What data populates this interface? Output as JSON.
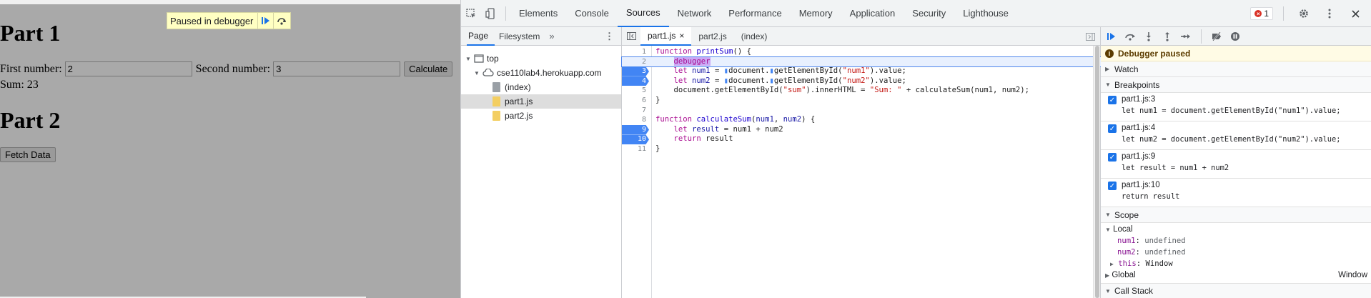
{
  "page": {
    "part1_heading": "Part 1",
    "first_number_label": "First number:",
    "first_number_value": "2",
    "second_number_label": "Second number:",
    "second_number_value": "3",
    "calculate_label": "Calculate",
    "sum_text": "Sum: 23",
    "part2_heading": "Part 2",
    "fetch_label": "Fetch Data",
    "overlay_label": "Paused in debugger"
  },
  "devtools": {
    "tabs": [
      "Elements",
      "Console",
      "Sources",
      "Network",
      "Performance",
      "Memory",
      "Application",
      "Security",
      "Lighthouse"
    ],
    "active_tab": "Sources",
    "error_count": "1",
    "navigator": {
      "tabs": [
        "Page",
        "Filesystem"
      ],
      "tree": {
        "top": "top",
        "host": "cse110lab4.herokuapp.com",
        "files": [
          "(index)",
          "part1.js",
          "part2.js"
        ],
        "selected": "part1.js"
      }
    },
    "editor": {
      "tabs": [
        "part1.js",
        "part2.js",
        "(index)"
      ],
      "active_tab": "part1.js",
      "breakpoint_lines": [
        3,
        4,
        9,
        10
      ],
      "paused_line": 2
    },
    "sidebar": {
      "paused_label": "Debugger paused",
      "watch_label": "Watch",
      "breakpoints_label": "Breakpoints",
      "breakpoints": [
        {
          "location": "part1.js:3",
          "code": "let num1 = document.getElementById(\"num1\").value;"
        },
        {
          "location": "part1.js:4",
          "code": "let num2 = document.getElementById(\"num2\").value;"
        },
        {
          "location": "part1.js:9",
          "code": "let result = num1 + num2"
        },
        {
          "location": "part1.js:10",
          "code": "return result"
        }
      ],
      "scope_label": "Scope",
      "local_label": "Local",
      "scope_vars": [
        {
          "name": "num1",
          "value": "undefined"
        },
        {
          "name": "num2",
          "value": "undefined"
        },
        {
          "name": "this",
          "value": "Window"
        }
      ],
      "global_label": "Global",
      "global_value": "Window",
      "call_stack_label": "Call Stack"
    }
  },
  "colors": {
    "page_bg": "#a9a9a9",
    "accent": "#1a73e8",
    "breakpoint": "#4285f4",
    "overlay_bg": "#ffffc2"
  }
}
